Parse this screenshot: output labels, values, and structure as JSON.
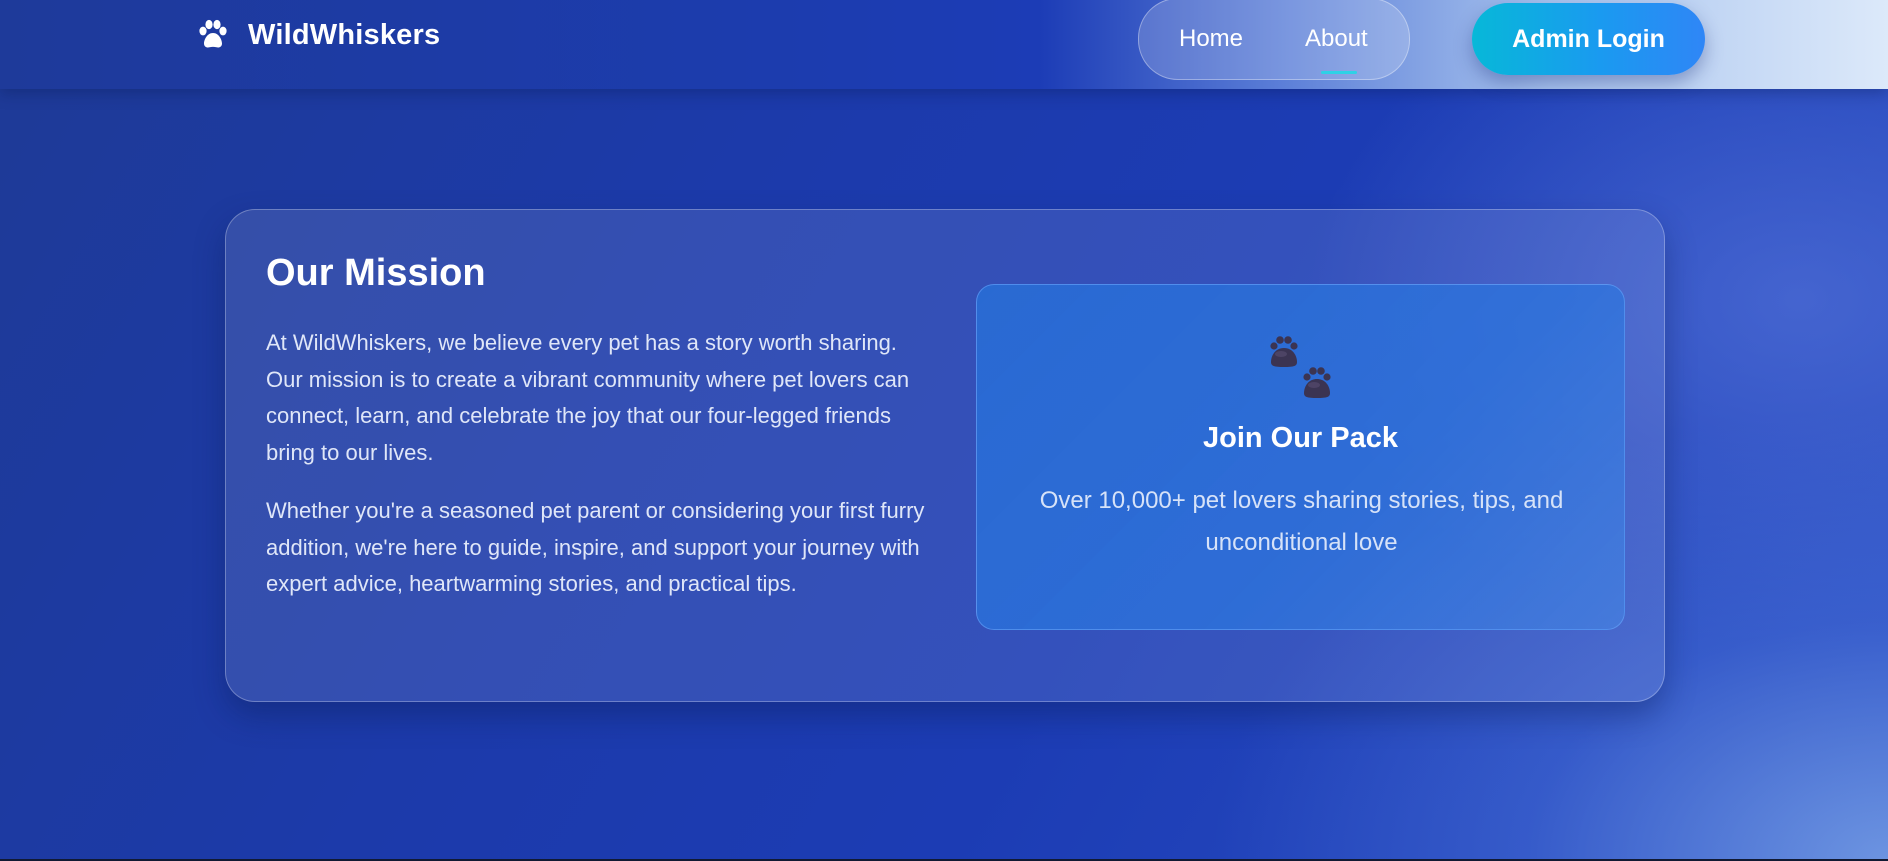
{
  "header": {
    "brand_name": "WildWhiskers",
    "logo_icon": "paw-icon",
    "nav": [
      {
        "label": "Home",
        "active": false
      },
      {
        "label": "About",
        "active": true
      }
    ],
    "admin_button_label": "Admin Login"
  },
  "mission": {
    "title": "Our Mission",
    "paragraphs": [
      "At WildWhiskers, we believe every pet has a story worth sharing. Our mission is to create a vibrant community where pet lovers can connect, learn, and celebrate the joy that our four-legged friends bring to our lives.",
      "Whether you're a seasoned pet parent or considering your first furry addition, we're here to guide, inspire, and support your journey with expert advice, heartwarming stories, and practical tips."
    ]
  },
  "pack": {
    "icon": "paw-prints-icon",
    "title": "Join Our Pack",
    "text": "Over 10,000+ pet lovers sharing stories, tips, and unconditional love"
  },
  "colors": {
    "accent_cyan": "#2ed1e6",
    "button_gradient_start": "#07b8d8",
    "button_gradient_end": "#2f86f6",
    "background": "#1c3aaa"
  }
}
